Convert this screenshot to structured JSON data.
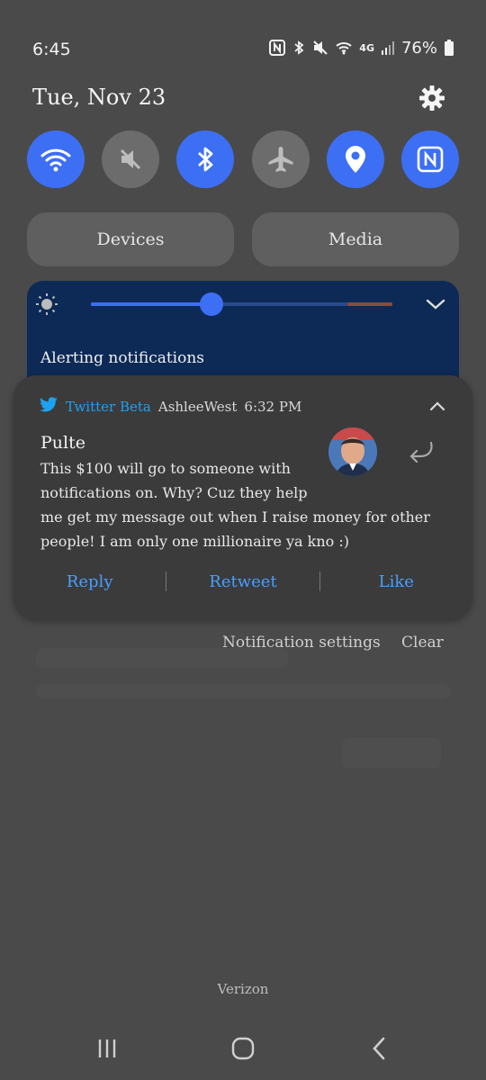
{
  "status_bar": {
    "time": "6:45",
    "icons": [
      "nfc-icon",
      "bluetooth-icon",
      "mute-icon",
      "wifi-icon",
      "4g-icon",
      "signal-icon"
    ],
    "network_label": "4G",
    "battery": "76%"
  },
  "quick_panel": {
    "date": "Tue, Nov 23",
    "toggles": [
      {
        "name": "wifi",
        "icon": "wifi-icon",
        "on": true
      },
      {
        "name": "sound",
        "icon": "mute-icon",
        "on": false
      },
      {
        "name": "bluetooth",
        "icon": "bluetooth-icon",
        "on": true
      },
      {
        "name": "airplane-mode",
        "icon": "airplane-icon",
        "on": false
      },
      {
        "name": "location",
        "icon": "location-icon",
        "on": true
      },
      {
        "name": "nfc",
        "icon": "nfc-icon",
        "on": true
      }
    ],
    "devices_label": "Devices",
    "media_label": "Media",
    "brightness": 0.4
  },
  "notifications": {
    "section_label": "Alerting notifications",
    "card": {
      "app_name": "Twitter Beta",
      "account": "AshleeWest",
      "time": "6:32 PM",
      "sender": "Pulte",
      "message_lines": [
        "This $100 will go to someone with",
        "notifications on. Why? Cuz they help",
        "me get my message out when I raise money for other",
        "people! I am only one millionaire ya kno :)"
      ],
      "actions": {
        "reply": "Reply",
        "retweet": "Retweet",
        "like": "Like"
      }
    },
    "settings_label": "Notification settings",
    "clear_label": "Clear"
  },
  "carrier": "Verizon",
  "colors": {
    "accent": "#3d6ff5",
    "twitter_blue": "#1da1f2",
    "action_blue": "#4a9eff",
    "card_bg": "#3b3b3b",
    "panel_bg": "#4a4a4a"
  }
}
